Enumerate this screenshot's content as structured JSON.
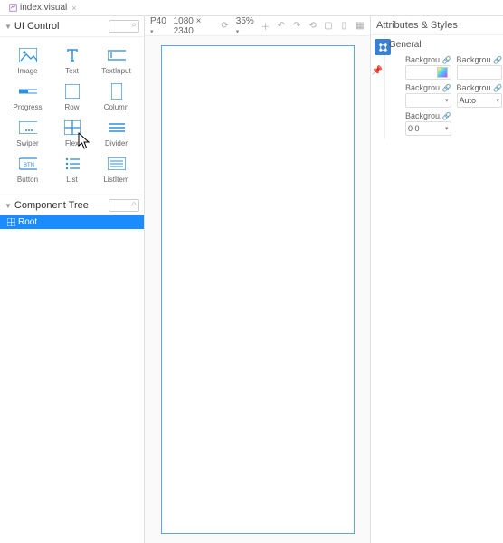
{
  "tab": {
    "name": "index.visual"
  },
  "leftPanel": {
    "title": "UI Control",
    "items": [
      {
        "label": "Image"
      },
      {
        "label": "Text"
      },
      {
        "label": "TextInput"
      },
      {
        "label": "Progress"
      },
      {
        "label": "Row"
      },
      {
        "label": "Column"
      },
      {
        "label": "Swiper"
      },
      {
        "label": "Flex"
      },
      {
        "label": "Divider"
      },
      {
        "label": "Button"
      },
      {
        "label": "List"
      },
      {
        "label": "ListItem"
      }
    ]
  },
  "tree": {
    "title": "Component Tree",
    "root": "Root"
  },
  "canvas": {
    "device": "P40",
    "resolution": "1080 × 2340",
    "zoom": "35%"
  },
  "right": {
    "title": "Attributes & Styles",
    "general": "General",
    "bgA": "Backgrou.",
    "bgB": "Backgrou.",
    "bgC": "Backgrou.",
    "bgD": "Backgrou.",
    "bgE": "Backgrou.",
    "autoValue": "Auto",
    "zeroZero": "0 0"
  }
}
